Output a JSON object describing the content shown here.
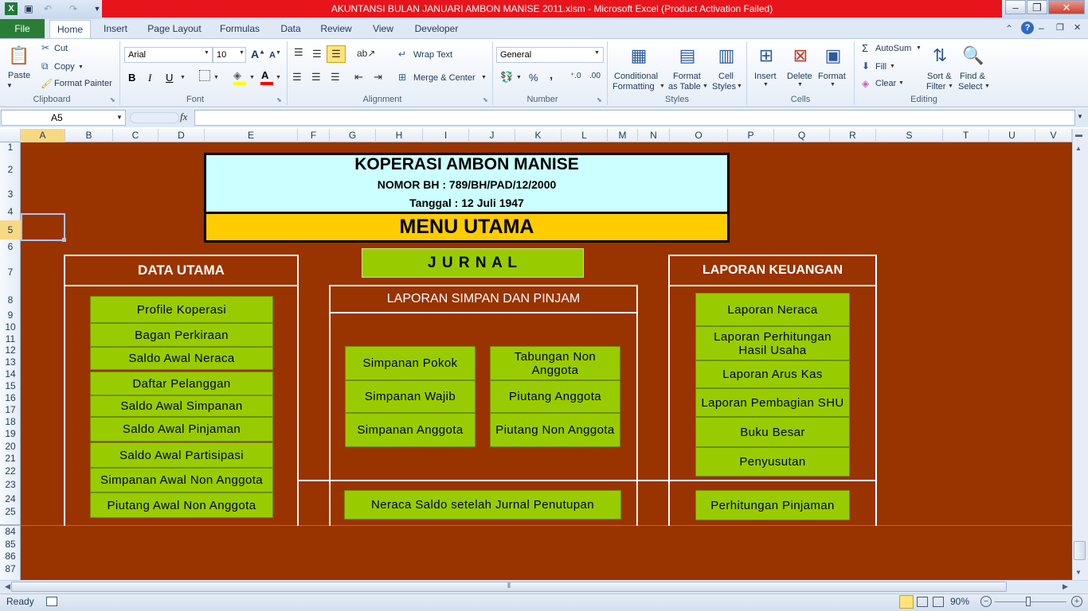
{
  "title": "AKUNTANSI BULAN JANUARI AMBON MANISE 2011.xlsm  -  Microsoft Excel (Product Activation Failed)",
  "qat_icons": [
    "excel-icon",
    "save-icon",
    "undo-icon",
    "redo-icon",
    "customize-qat-icon"
  ],
  "window_controls": {
    "minimize": "–",
    "restore": "❐",
    "close": "✕"
  },
  "tabs": {
    "file": "File",
    "home": "Home",
    "items": [
      "Insert",
      "Page Layout",
      "Formulas",
      "Data",
      "Review",
      "View",
      "Developer"
    ]
  },
  "ribbon": {
    "clipboard": {
      "paste": "Paste",
      "cut": "Cut",
      "copy": "Copy",
      "format_painter": "Format Painter",
      "label": "Clipboard"
    },
    "font": {
      "name": "Arial",
      "size": "10",
      "bold": "B",
      "italic": "I",
      "underline": "U",
      "label": "Font"
    },
    "alignment": {
      "wrap_text": "Wrap Text",
      "merge_center": "Merge & Center",
      "label": "Alignment"
    },
    "number": {
      "format": "General",
      "percent": "%",
      "comma": ",",
      "label": "Number"
    },
    "styles": {
      "conditional": "Conditional",
      "conditional2": "Formatting",
      "format_table": "Format",
      "format_table2": "as Table",
      "cell_styles": "Cell",
      "cell_styles2": "Styles",
      "label": "Styles"
    },
    "cells": {
      "insert": "Insert",
      "delete": "Delete",
      "format": "Format",
      "label": "Cells"
    },
    "editing": {
      "autosum": "AutoSum",
      "fill": "Fill",
      "clear": "Clear",
      "sort": "Sort &",
      "sort2": "Filter",
      "find": "Find &",
      "find2": "Select",
      "label": "Editing"
    }
  },
  "formula_bar": {
    "name_box": "A5",
    "fx": "fx",
    "formula": ""
  },
  "columns": [
    "A",
    "B",
    "C",
    "D",
    "E",
    "F",
    "G",
    "H",
    "I",
    "J",
    "K",
    "L",
    "M",
    "N",
    "O",
    "P",
    "Q",
    "R",
    "S",
    "T",
    "U",
    "V"
  ],
  "rows": [
    "1",
    "2",
    "3",
    "4",
    "5",
    "6",
    "7",
    "8",
    "9",
    "10",
    "11",
    "12",
    "13",
    "14",
    "15",
    "16",
    "17",
    "18",
    "19",
    "20",
    "21",
    "22",
    "23",
    "24",
    "25",
    "84",
    "85",
    "86",
    "87"
  ],
  "sheet": {
    "company": "KOPERASI AMBON MANISE",
    "nomor": "NOMOR BH : 789/BH/PAD/12/2000",
    "tanggal": "Tanggal : 12 Juli 1947",
    "menu": "MENU UTAMA",
    "jurnal": "J U R N A L",
    "data_utama": {
      "title": "DATA UTAMA",
      "items": [
        "Profile  Koperasi",
        "Bagan Perkiraan",
        "Saldo Awal Neraca",
        "Daftar Pelanggan",
        "Saldo Awal Simpanan",
        "Saldo Awal Pinjaman",
        "Saldo Awal Partisipasi",
        "Simpanan  Awal Non Anggota",
        "Piutang Awal Non Anggota"
      ]
    },
    "simpan_pinjam": {
      "title": "LAPORAN SIMPAN DAN PINJAM",
      "left": [
        "Simpanan  Pokok",
        "Simpanan  Wajib",
        "Simpanan  Anggota"
      ],
      "right": [
        "Tabungan Non Anggota",
        "Piutang  Anggota",
        "Piutang Non Anggota"
      ],
      "bottom": "Neraca  Saldo setelah Jurnal Penutupan"
    },
    "laporan_keuangan": {
      "title": "LAPORAN KEUANGAN",
      "items": [
        "Laporan Neraca",
        "Laporan Perhitungan Hasil Usaha",
        "Laporan Arus Kas",
        "Laporan Pembagian  SHU",
        "Buku Besar",
        "Penyusutan"
      ],
      "bottom": "Perhitungan  Pinjaman"
    }
  },
  "status": {
    "ready": "Ready",
    "zoom": "90%"
  }
}
